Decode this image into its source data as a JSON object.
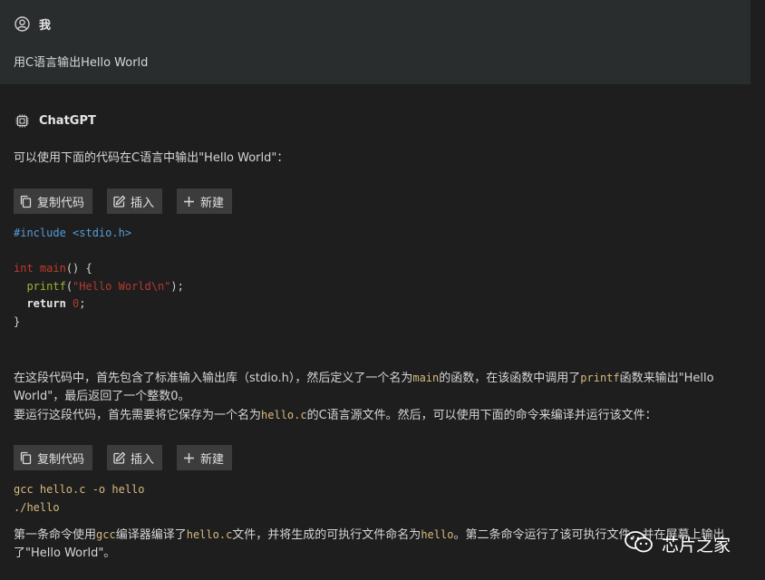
{
  "user": {
    "name": "我",
    "message": "用C语言输出Hello World"
  },
  "assistant": {
    "name": "ChatGPT",
    "intro": "可以使用下面的代码在C语言中输出\"Hello World\"：",
    "toolbar": {
      "copy_label": "复制代码",
      "insert_label": "插入",
      "new_label": "新建"
    },
    "code1": {
      "include_directive": "#include",
      "include_header": "<stdio.h>",
      "kw_int": "int",
      "kw_main": "main",
      "main_tail": "() {",
      "printf_fn": "printf",
      "paren_open": "(",
      "printf_str": "\"Hello World\\n\"",
      "paren_close": ");",
      "kw_return": "return",
      "ret_num": "0",
      "semicolon": ";",
      "close_brace": "}"
    },
    "explain": {
      "p1_a": "在这段代码中，首先包含了标准输入输出库（stdio.h），然后定义了一个名为",
      "p1_code1": "main",
      "p1_b": "的函数，在该函数中调用了",
      "p1_code2": "printf",
      "p1_c": "函数来输出\"Hello",
      "p1_d": "World\"，最后返回了一个整数0。",
      "p2_a": "要运行这段代码，首先需要将它保存为一个名为",
      "p2_code": "hello.c",
      "p2_b": "的C语言源文件。然后，可以使用下面的命令来编译并运行该文件："
    },
    "code2": {
      "line1": "gcc hello.c -o hello",
      "line2": "./hello"
    },
    "final": {
      "a": "第一条命令使用",
      "code1": "gcc",
      "b": "编译器编译了",
      "code2": "hello.c",
      "c": "文件，并将生成的可执行文件命名为",
      "code3": "hello",
      "d": "。第二条命令运行了该可执行文件，并在屏幕上输出",
      "e": "了\"Hello World\"。"
    }
  },
  "watermark": {
    "text": "芯片之家"
  },
  "colors": {
    "background": "#1e1e1e",
    "user_block": "#2a2d2e",
    "button_bg": "#3c3c3c",
    "preprocessor": "#569cd6",
    "keyword": "#c0392b",
    "function": "#9cb433",
    "string": "#b33b2e",
    "inline_code": "#d7ba7d"
  },
  "icons": {
    "user": "user-circle-icon",
    "assistant": "chip-icon",
    "copy": "copy-icon",
    "insert": "edit-icon",
    "new": "plus-icon",
    "watermark": "wechat-icon"
  }
}
